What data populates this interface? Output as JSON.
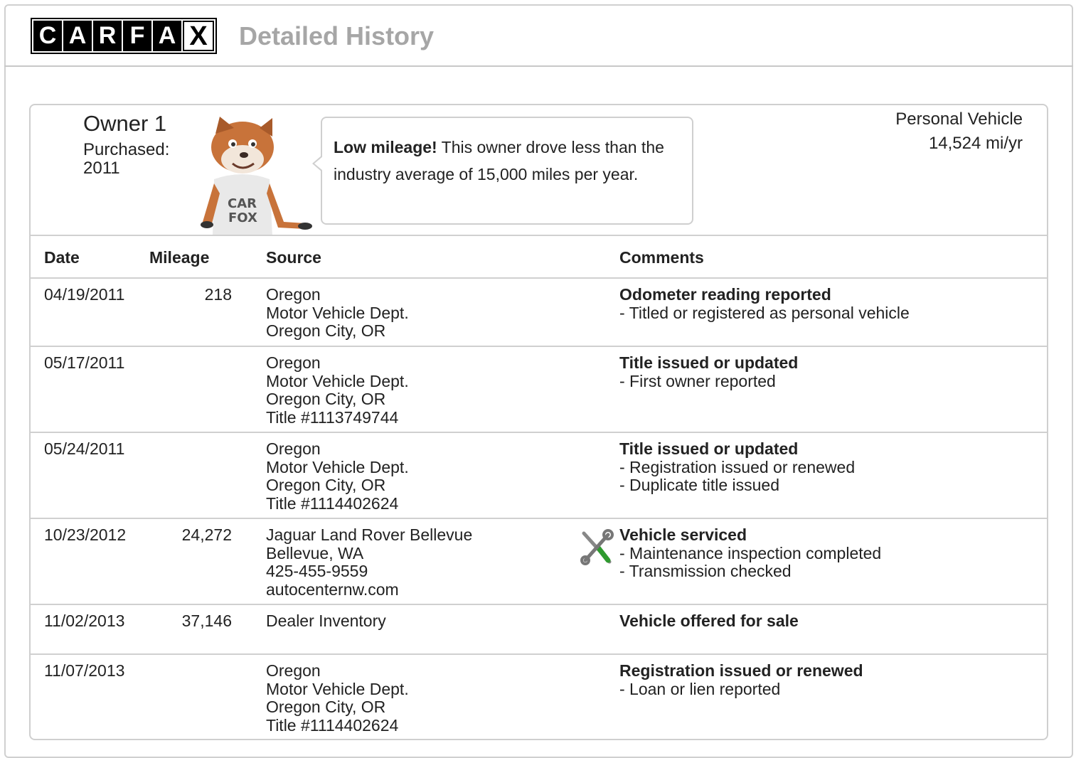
{
  "header": {
    "logo_letters": [
      "C",
      "A",
      "R",
      "F",
      "A",
      "X"
    ],
    "title": "Detailed History"
  },
  "owner": {
    "title": "Owner 1",
    "purchased_label": "Purchased:",
    "purchased_year": "2011",
    "vehicle_type": "Personal Vehicle",
    "miles_per_year": "14,524 mi/yr",
    "bubble_bold": "Low mileage!",
    "bubble_text": " This owner drove less than the industry average of 15,000 miles per year.",
    "mascot_shirt": [
      "CAR",
      "FOX"
    ]
  },
  "table": {
    "columns": [
      "Date",
      "Mileage",
      "Source",
      "Comments"
    ],
    "rows": [
      {
        "date": "04/19/2011",
        "mileage": "218",
        "source": [
          "Oregon",
          "Motor Vehicle Dept.",
          "Oregon City, OR"
        ],
        "headline": "Odometer reading reported",
        "details": [
          "- Titled or registered as personal vehicle"
        ]
      },
      {
        "date": "05/17/2011",
        "mileage": "",
        "source": [
          "Oregon",
          "Motor Vehicle Dept.",
          "Oregon City, OR",
          "Title #1113749744"
        ],
        "headline": "Title issued or updated",
        "details": [
          "- First owner reported"
        ]
      },
      {
        "date": "05/24/2011",
        "mileage": "",
        "source": [
          "Oregon",
          "Motor Vehicle Dept.",
          "Oregon City, OR",
          "Title #1114402624"
        ],
        "headline": "Title issued or updated",
        "details": [
          "- Registration issued or renewed",
          "- Duplicate title issued"
        ]
      },
      {
        "date": "10/23/2012",
        "mileage": "24,272",
        "source": [
          "Jaguar Land Rover Bellevue",
          "Bellevue, WA",
          "425-455-9559",
          "autocenternw.com"
        ],
        "headline": "Vehicle serviced",
        "details": [
          "- Maintenance inspection completed",
          "- Transmission checked"
        ],
        "icon": "service-tools-icon"
      },
      {
        "date": "11/02/2013",
        "mileage": "37,146",
        "source": [
          "Dealer Inventory"
        ],
        "headline": "Vehicle offered for sale",
        "details": []
      },
      {
        "date": "11/07/2013",
        "mileage": "",
        "source": [
          "Oregon",
          "Motor Vehicle Dept.",
          "Oregon City, OR",
          "Title #1114402624"
        ],
        "headline": "Registration issued or renewed",
        "details": [
          "- Loan or lien reported"
        ]
      }
    ]
  }
}
